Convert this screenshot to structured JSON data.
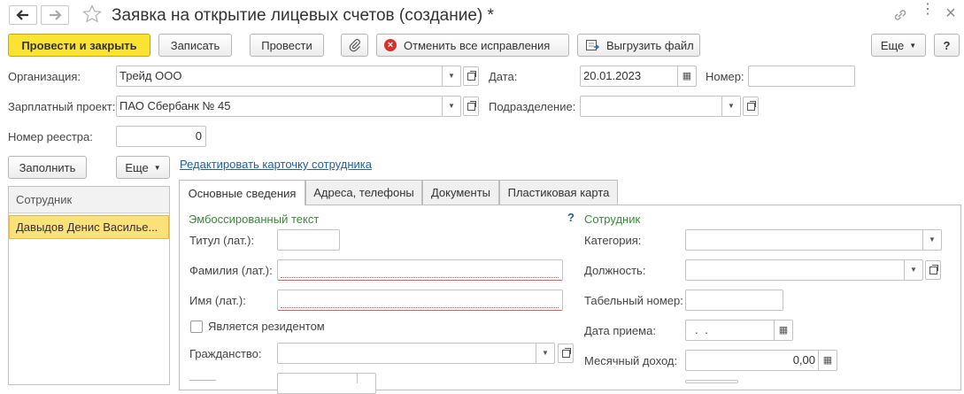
{
  "window": {
    "title": "Заявка на открытие лицевых счетов (создание) *"
  },
  "toolbar": {
    "post_close": "Провести и закрыть",
    "write": "Записать",
    "post": "Провести",
    "cancel_fixes": "Отменить все исправления",
    "export_file": "Выгрузить файл",
    "more": "Еще",
    "help": "?"
  },
  "header": {
    "org_label": "Организация:",
    "org_value": "Трейд ООО",
    "date_label": "Дата:",
    "date_value": "20.01.2023",
    "number_label": "Номер:",
    "number_value": "",
    "salary_label": "Зарплатный проект:",
    "salary_value": "ПАО Сбербанк №  45",
    "dept_label": "Подразделение:",
    "dept_value": "",
    "registry_label": "Номер реестра:",
    "registry_value": "0"
  },
  "left": {
    "fill_button": "Заполнить",
    "more_button": "Еще",
    "column_header": "Сотрудник",
    "rows": [
      "Давыдов Денис Василье..."
    ]
  },
  "edit_link": "Редактировать карточку сотрудника",
  "tabs": [
    "Основные сведения",
    "Адреса, телефоны",
    "Документы",
    "Пластиковая карта"
  ],
  "emboss": {
    "title": "Эмбоссированный текст",
    "help": "?",
    "titul_label": "Титул (лат.):",
    "titul_value": "",
    "surname_label": "Фамилия (лат.):",
    "surname_value": "",
    "name_label": "Имя (лат.):",
    "name_value": "",
    "resident_label": "Является резидентом",
    "citizenship_label": "Гражданство:",
    "citizenship_value": ""
  },
  "employee": {
    "title": "Сотрудник",
    "category_label": "Категория:",
    "category_value": "",
    "position_label": "Должность:",
    "position_value": "",
    "tab_number_label": "Табельный номер:",
    "tab_number_value": "",
    "hire_date_label": "Дата приема:",
    "hire_date_value": " .  .",
    "income_label": "Месячный доход:",
    "income_value": "0,00"
  },
  "colors": {
    "primary_button": "#fbe334",
    "selected_row": "#fbe17a",
    "section_title": "#3a8a3a",
    "link": "#1f5ea8"
  }
}
